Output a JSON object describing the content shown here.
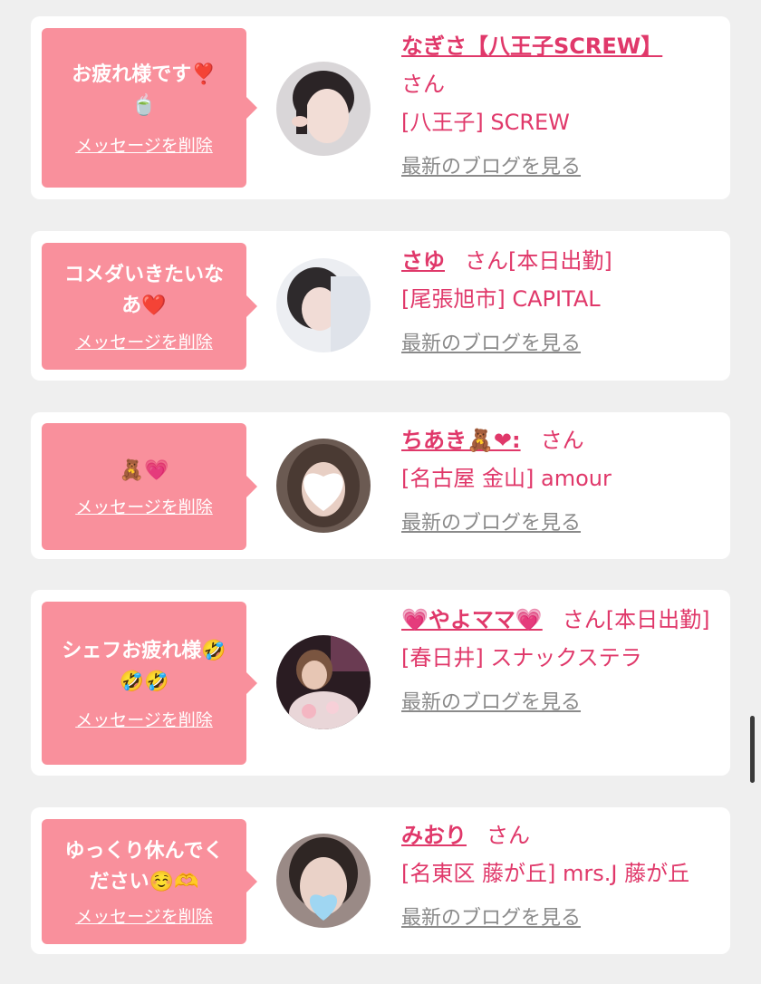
{
  "delete_label": "メッセージを削除",
  "blog_label": "最新のブログを見る",
  "san_label": "さん",
  "colors": {
    "accent": "#e0386a",
    "bubble": "#f9909c",
    "muted": "#8a8a8a",
    "background": "#efefef"
  },
  "messages": [
    {
      "bubble_text": "お疲れ様です❣️",
      "bubble_text2": "🍵",
      "name": "なぎさ【八王子SCREW】",
      "extra": "",
      "shop": "[八王子] SCREW"
    },
    {
      "bubble_text": "コメダいきたいな",
      "bubble_text2": "あ❤️",
      "name": "さゆ",
      "extra": "[本日出勤]",
      "shop": "[尾張旭市] CAPITAL"
    },
    {
      "bubble_text": "🧸💗",
      "bubble_text2": "",
      "name": "ちあき🧸❤︎:",
      "extra": "",
      "shop": "[名古屋 金山] amour"
    },
    {
      "bubble_text": "シェフお疲れ様🤣",
      "bubble_text2": "🤣🤣",
      "name": "💗やよママ💗",
      "extra": "[本日出勤]",
      "shop": "[春日井] スナックステラ"
    },
    {
      "bubble_text": "ゆっくり休んでく",
      "bubble_text2": "ださい☺️🫶",
      "name": "みおり",
      "extra": "",
      "shop": "[名東区 藤が丘] mrs.J 藤が丘"
    }
  ]
}
